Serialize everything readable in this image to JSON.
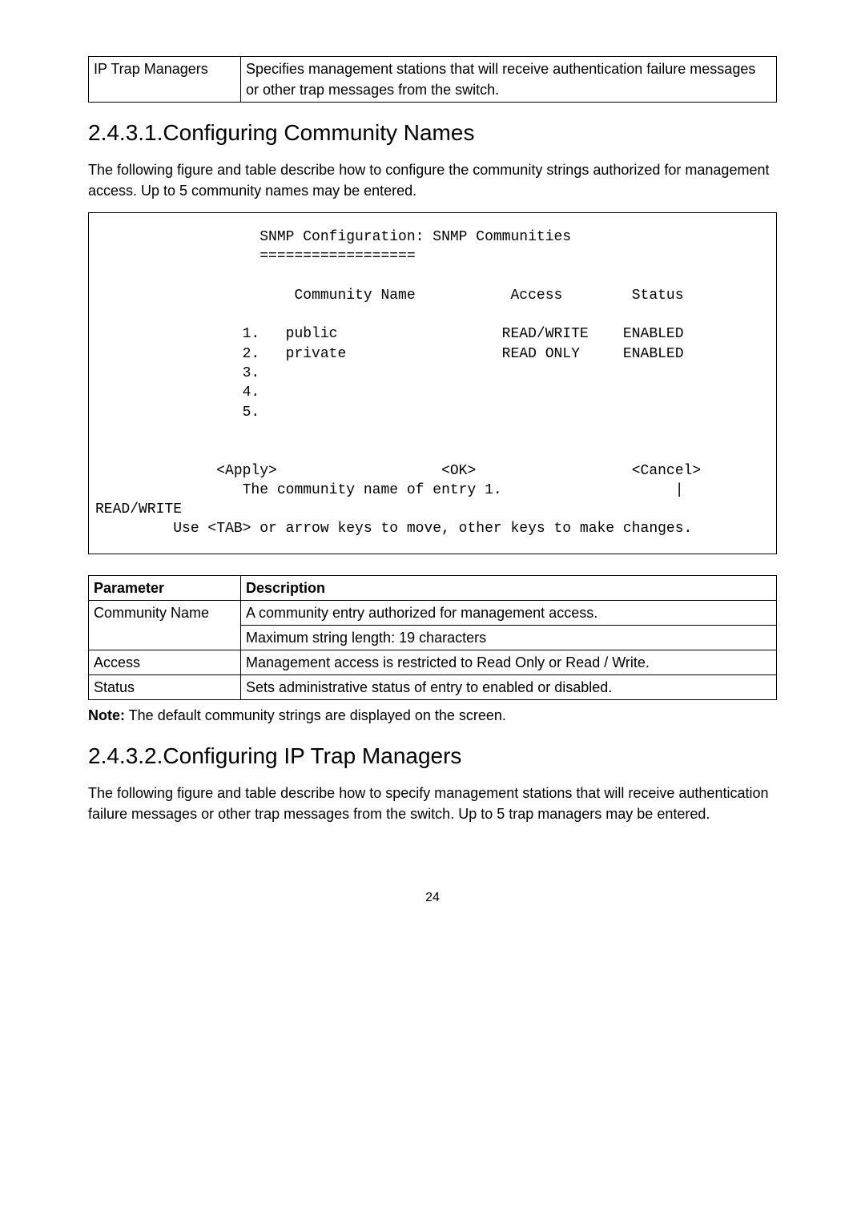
{
  "top_table": {
    "param": "IP Trap Managers",
    "desc": "Specifies management stations that will receive authentication failure messages or other trap messages from the switch."
  },
  "sec1": {
    "heading": "2.4.3.1.Configuring Community Names",
    "para": "The following figure and table describe how to configure the community strings authorized for management access. Up to 5 community names may be entered."
  },
  "code1": "                   SNMP Configuration: SNMP Communities\n                   ==================\n\n                       Community Name           Access        Status\n\n                 1.   public                   READ/WRITE    ENABLED\n                 2.   private                  READ ONLY     ENABLED\n                 3.\n                 4.\n                 5.\n\n\n              <Apply>                   <OK>                  <Cancel>\n                 The community name of entry 1.                    |\nREAD/WRITE\n         Use <TAB> or arrow keys to move, other keys to make changes.",
  "params_table": {
    "header_param": "Parameter",
    "header_desc": "Description",
    "rows": [
      {
        "param": "Community Name",
        "desc_l1": "A community entry authorized for management access.",
        "desc_l2": "Maximum string length: 19 characters"
      },
      {
        "param": "Access",
        "desc_l1": "Management access is restricted to Read Only or Read / Write."
      },
      {
        "param": "Status",
        "desc_l1": "Sets administrative status of entry to enabled or disabled."
      }
    ]
  },
  "note1": {
    "label": "Note:",
    "text": " The default community strings are displayed on the screen."
  },
  "sec2": {
    "heading": "2.4.3.2.Configuring IP Trap Managers",
    "para": "The following figure and table describe how to specify management stations that will receive authentication failure messages or other trap messages from the switch. Up to 5 trap managers may be entered."
  },
  "page_num": "24"
}
